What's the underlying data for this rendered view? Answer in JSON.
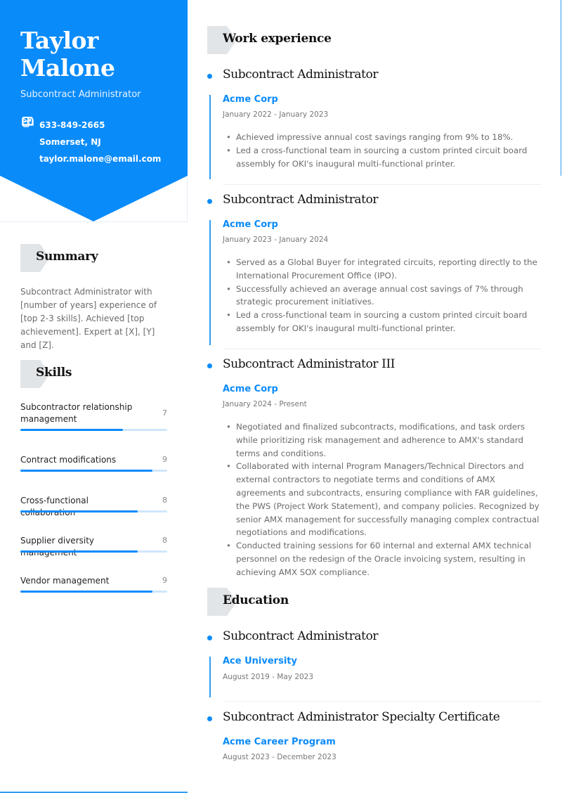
{
  "colors": {
    "accent": "#0A8BFA",
    "section_tab": "#E2E5E8"
  },
  "profile": {
    "first_name": "Taylor",
    "last_name": "Malone",
    "headline": "Subcontract Administrator",
    "contacts": [
      {
        "icon": "phone-icon",
        "text": "633-849-2665"
      },
      {
        "icon": "mailbox-icon",
        "text": "Somerset, NJ"
      },
      {
        "icon": "envelope-icon",
        "text": "taylor.malone@email.com"
      }
    ]
  },
  "summary": {
    "title": "Summary",
    "text": "Subcontract Administrator with [number of years] experience of [top 2-3 skills]. Achieved [top achievement]. Expert at [X], [Y] and [Z]."
  },
  "skills": {
    "title": "Skills",
    "max": 10,
    "items": [
      {
        "name": "Subcontractor relationship management",
        "level": 7
      },
      {
        "name": "Contract modifications",
        "level": 9
      },
      {
        "name": "Cross-functional collaboration",
        "level": 8
      },
      {
        "name": "Supplier diversity management",
        "level": 8
      },
      {
        "name": "Vendor management",
        "level": 9
      }
    ]
  },
  "work": {
    "title": "Work experience",
    "items": [
      {
        "role": "Subcontract Administrator",
        "org": "Acme Corp",
        "dates": "January 2022 - January 2023",
        "bullets": [
          "Achieved impressive annual cost savings ranging from 9% to 18%.",
          "Led a cross-functional team in sourcing a custom printed circuit board assembly for OKI's inaugural multi-functional printer."
        ]
      },
      {
        "role": "Subcontract Administrator",
        "org": "Acme Corp",
        "dates": "January 2023 - January 2024",
        "bullets": [
          "Served as a Global Buyer for integrated circuits, reporting directly to the International Procurement Office (IPO).",
          "Successfully achieved an average annual cost savings of 7% through strategic procurement initiatives.",
          "Led a cross-functional team in sourcing a custom printed circuit board assembly for OKI's inaugural multi-functional printer."
        ]
      },
      {
        "role": "Subcontract Administrator III",
        "org": "Acme Corp",
        "dates": "January 2024 - Present",
        "bullets": [
          "Negotiated and finalized subcontracts, modifications, and task orders while prioritizing risk management and adherence to AMX's standard terms and conditions.",
          "Collaborated with internal Program Managers/Technical Directors and external contractors to negotiate terms and conditions of AMX agreements and subcontracts, ensuring compliance with FAR guidelines, the PWS (Project Work Statement), and company policies. Recognized by senior AMX management for successfully managing complex contractual negotiations and modifications.",
          "Conducted training sessions for 60 internal and external AMX technical personnel on the redesign of the Oracle invoicing system, resulting in achieving AMX SOX compliance."
        ]
      }
    ]
  },
  "education": {
    "title": "Education",
    "items": [
      {
        "role": "Subcontract Administrator",
        "org": "Ace University",
        "dates": "August 2019 - May 2023"
      },
      {
        "role": "Subcontract Administrator Specialty Certificate",
        "org": "Acme Career Program",
        "dates": "August 2023 - December 2023"
      }
    ]
  }
}
